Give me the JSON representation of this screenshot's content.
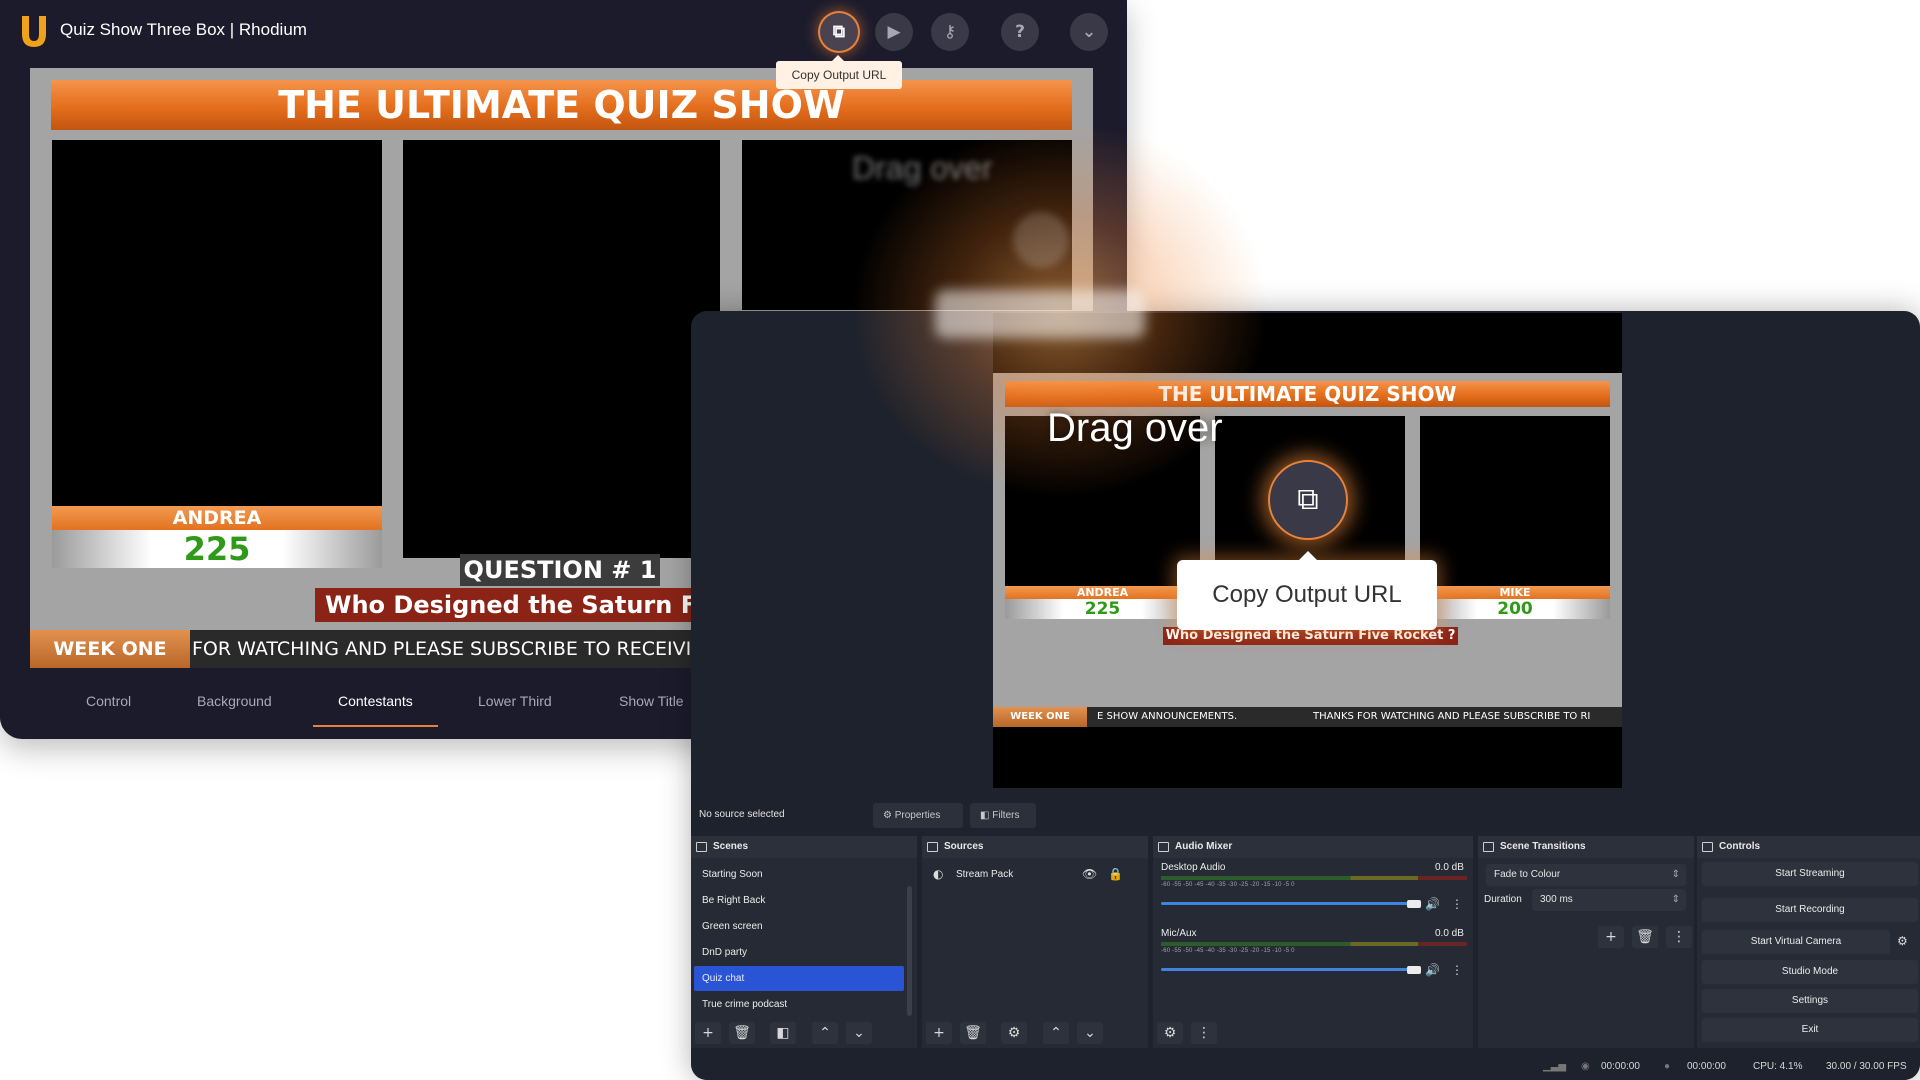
{
  "rhodium": {
    "title": "Quiz Show Three Box | Rhodium",
    "tooltip": "Copy Output URL",
    "buttons": {
      "copy": "⧉",
      "play": "▶",
      "key": "⚷",
      "help": "?",
      "menu": "⌄"
    },
    "tabs": [
      {
        "label": "Control"
      },
      {
        "label": "Background"
      },
      {
        "label": "Contestants"
      },
      {
        "label": "Lower Third"
      },
      {
        "label": "Show Title"
      }
    ],
    "active_tab": "Contestants",
    "accent_color": "#e8823a"
  },
  "quiz": {
    "title": "THE ULTIMATE QUIZ SHOW",
    "contestants": [
      {
        "name": "ANDREA",
        "score": "225"
      },
      {
        "name": "MIKE",
        "score": "200"
      }
    ],
    "question_number": "QUESTION # 1",
    "question_rhodium": "Who Designed the Saturn Five",
    "question_obs": "Who Designed the Saturn Five Rocket ?",
    "week": "WEEK ONE",
    "ticker_rhodium": "FOR WATCHING AND PLEASE SUBSCRIBE TO RECEIVI",
    "ticker_obs_1": "E SHOW ANNOUNCEMENTS.",
    "ticker_obs_2": "THANKS FOR WATCHING AND PLEASE SUBSCRIBE TO RI"
  },
  "overlay": {
    "drag_text": "Drag over",
    "copy_label": "Copy Output URL"
  },
  "obs": {
    "no_source": "No source selected",
    "properties": "Properties",
    "filters": "Filters",
    "scenes": {
      "header": "Scenes",
      "items": [
        "Starting Soon",
        "Be Right Back",
        "Green screen",
        "DnD party",
        "Quiz chat",
        "True crime podcast"
      ],
      "selected": "Quiz chat"
    },
    "sources": {
      "header": "Sources",
      "items": [
        "Stream Pack"
      ]
    },
    "mixer": {
      "header": "Audio Mixer",
      "channels": [
        {
          "name": "Desktop Audio",
          "db": "0.0 dB"
        },
        {
          "name": "Mic/Aux",
          "db": "0.0 dB"
        }
      ],
      "ticks": "-60  -55  -50  -45  -40  -35  -30  -25  -20  -15  -10  -5   0"
    },
    "transitions": {
      "header": "Scene Transitions",
      "type": "Fade to Colour",
      "duration_label": "Duration",
      "duration_value": "300 ms"
    },
    "controls": {
      "header": "Controls",
      "buttons": [
        "Start Streaming",
        "Start Recording",
        "Start Virtual Camera",
        "Studio Mode",
        "Settings",
        "Exit"
      ]
    },
    "status": {
      "time1": "00:00:00",
      "time2": "00:00:00",
      "cpu": "CPU: 4.1%",
      "fps": "30.00 / 30.00 FPS"
    },
    "highlight_color": "#2a54d6"
  }
}
